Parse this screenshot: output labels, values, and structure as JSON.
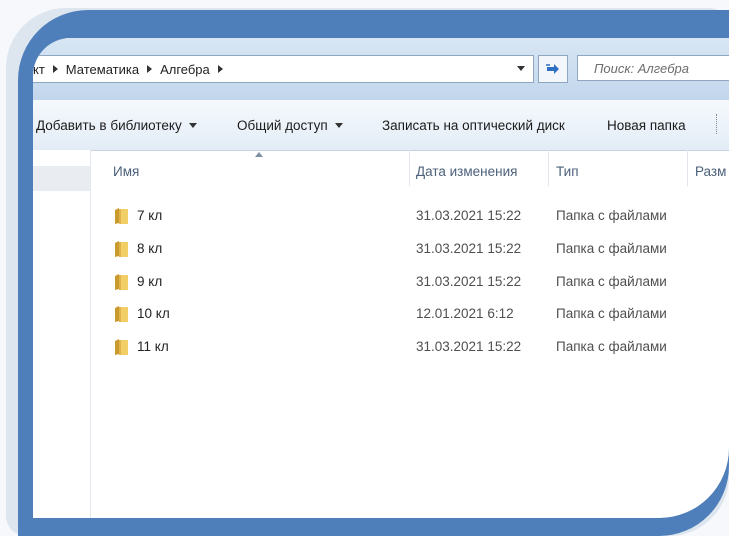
{
  "address_bar": {
    "crumbs": [
      "кт",
      "Математика",
      "Алгебра"
    ],
    "search_placeholder": "Поиск: Алгебра"
  },
  "toolbar": {
    "add_to_library": "Добавить в библиотеку",
    "share": "Общий доступ",
    "burn": "Записать на оптический диск",
    "new_folder": "Новая папка"
  },
  "columns": {
    "name": "Имя",
    "date": "Дата изменения",
    "type": "Тип",
    "size": "Разм"
  },
  "files": [
    {
      "name": "7 кл",
      "date": "31.03.2021 15:22",
      "type": "Папка с файлами"
    },
    {
      "name": "8 кл",
      "date": "31.03.2021 15:22",
      "type": "Папка с файлами"
    },
    {
      "name": "9 кл",
      "date": "31.03.2021 15:22",
      "type": "Папка с файлами"
    },
    {
      "name": "10 кл",
      "date": "12.01.2021 6:12",
      "type": "Папка с файлами"
    },
    {
      "name": "11 кл",
      "date": "31.03.2021 15:22",
      "type": "Папка с файлами"
    }
  ],
  "icons": {
    "folder": "folder-icon",
    "refresh": "refresh-icon"
  },
  "colors": {
    "frame": "#4f7fba",
    "folder": "#e9c45a"
  }
}
